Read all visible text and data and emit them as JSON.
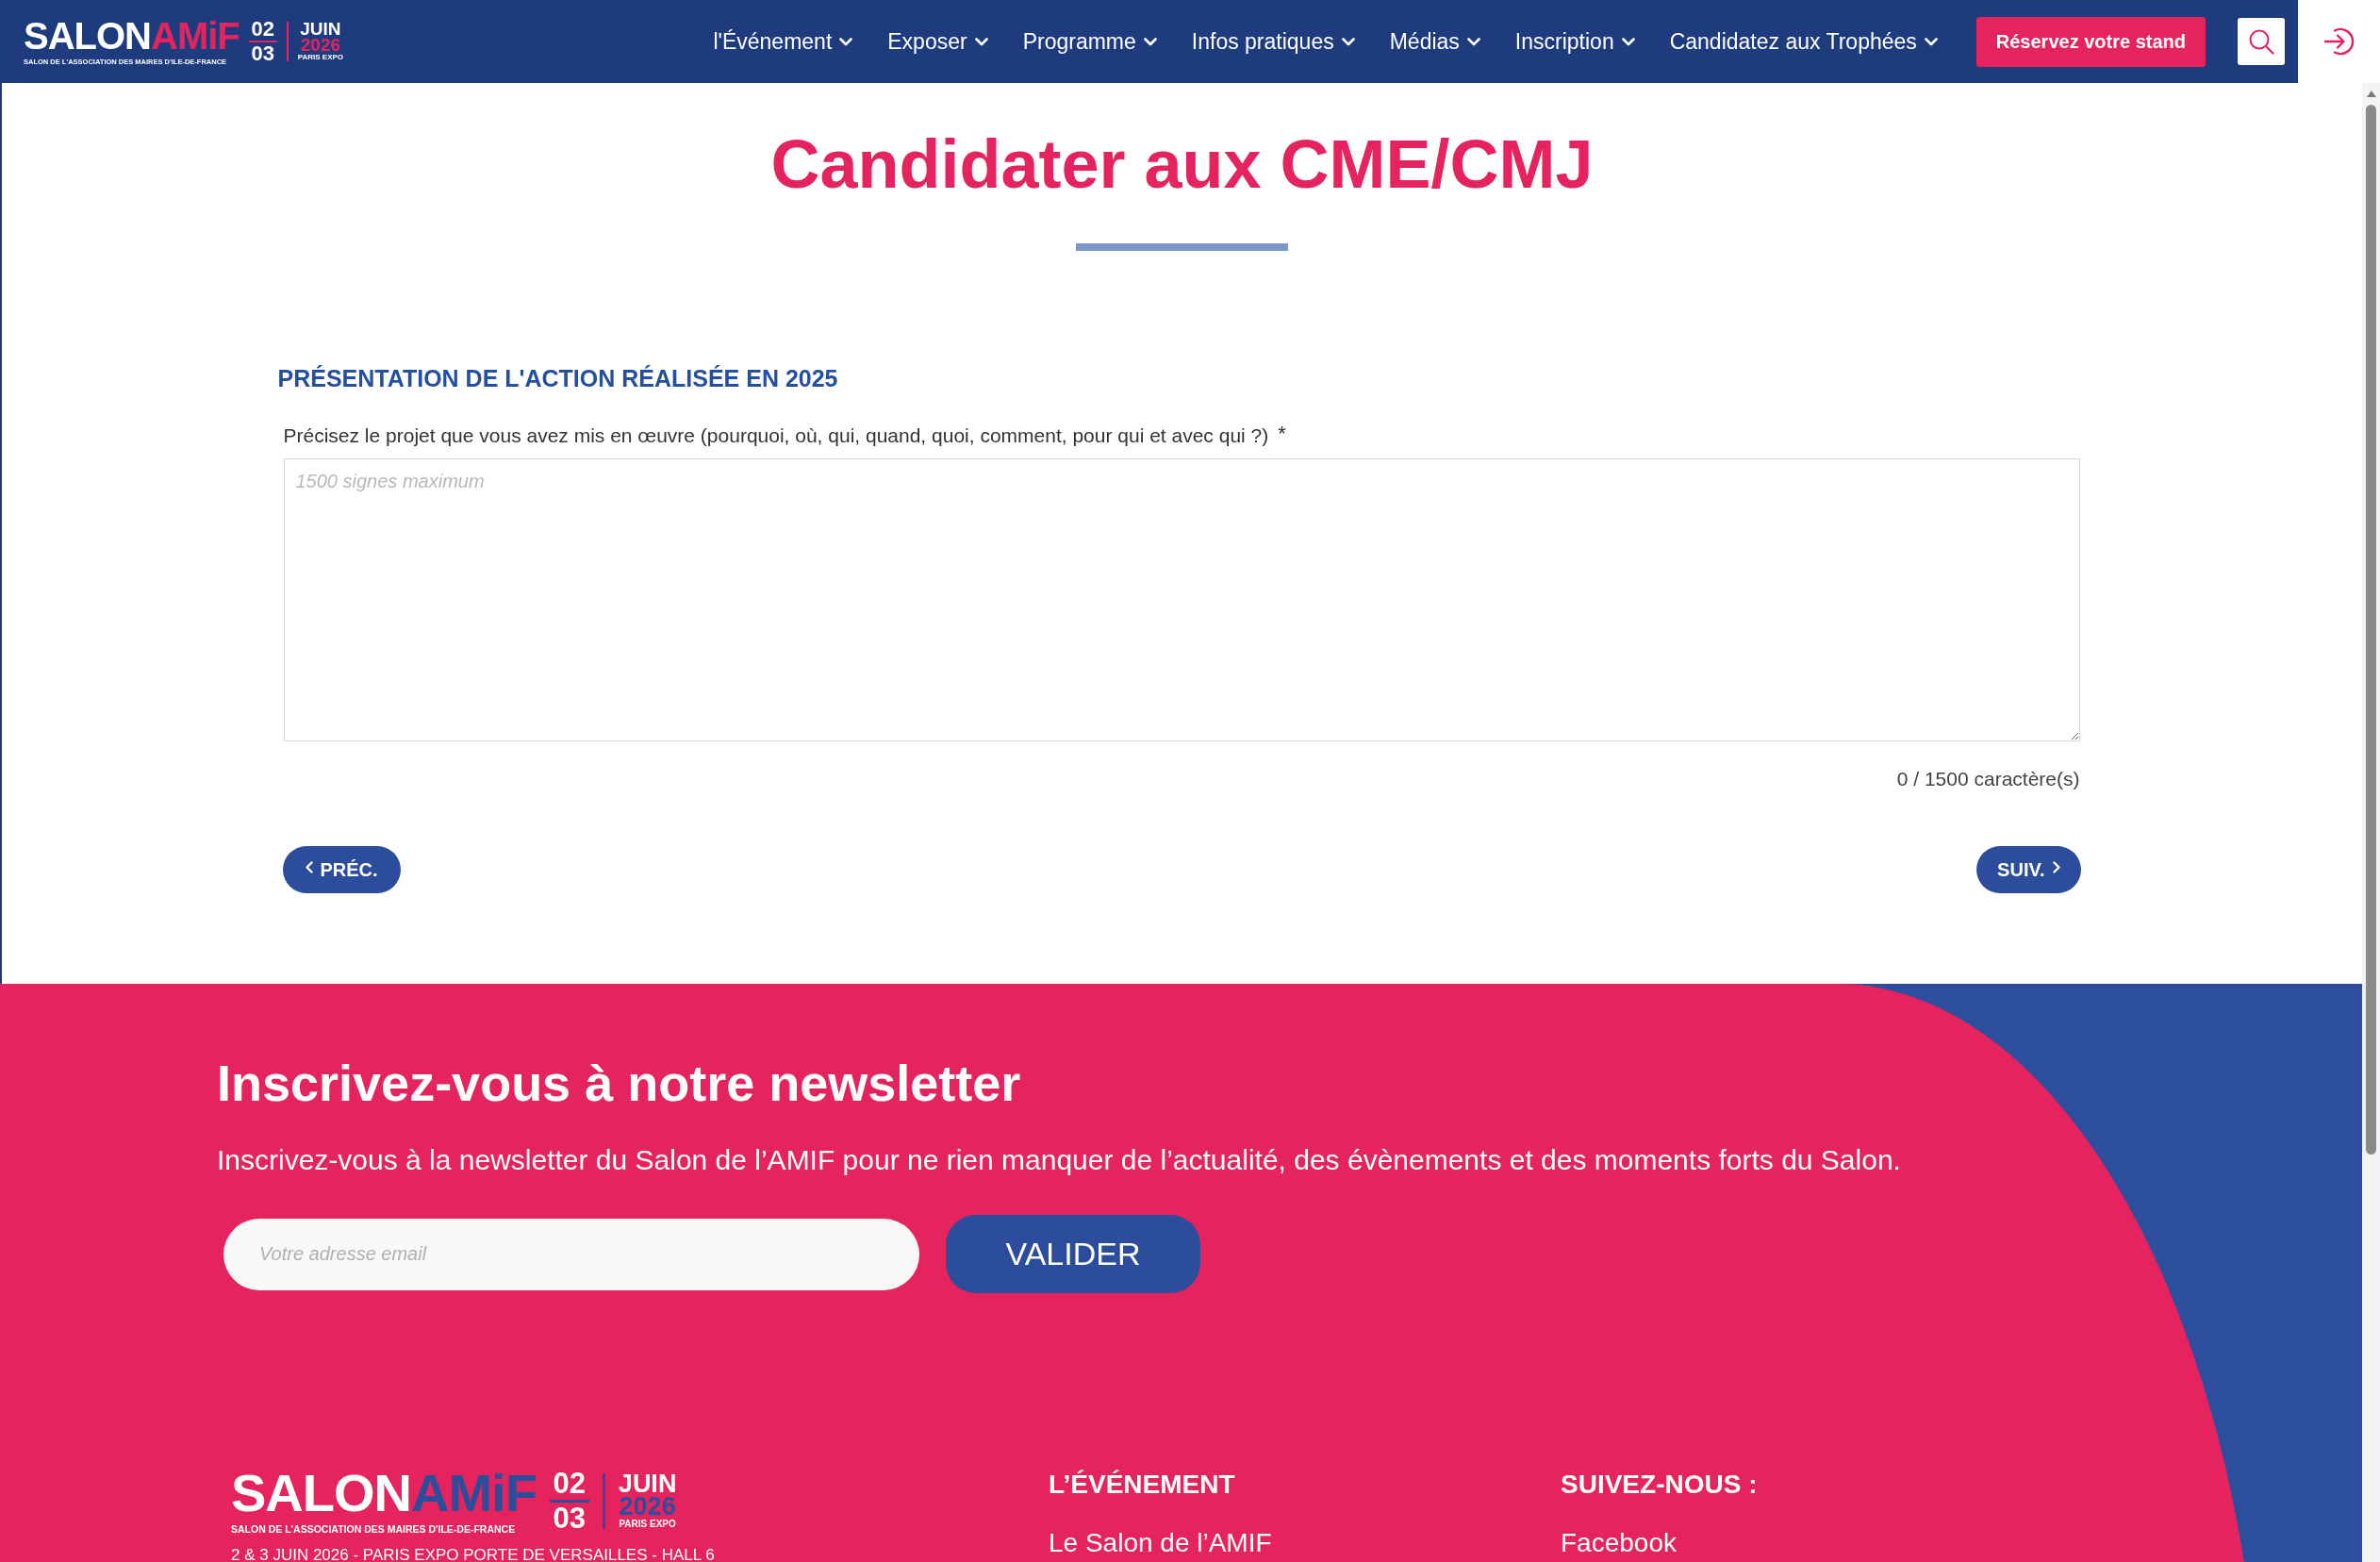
{
  "header": {
    "logo": {
      "wordmark_1": "SALON",
      "wordmark_2": "AMiF",
      "tagline": "SALON DE L'ASSOCIATION DES MAIRES D'ILE-DE-FRANCE",
      "day_1": "02",
      "day_2": "03",
      "month": "JUIN",
      "year": "2026",
      "venue": "PARIS EXPO"
    },
    "nav": [
      {
        "label": "l'Événement",
        "dropdown": true
      },
      {
        "label": "Exposer",
        "dropdown": true
      },
      {
        "label": "Programme",
        "dropdown": true
      },
      {
        "label": "Infos pratiques",
        "dropdown": true
      },
      {
        "label": "Médias",
        "dropdown": true
      },
      {
        "label": "Inscription",
        "dropdown": true
      },
      {
        "label": "Candidatez aux Trophées",
        "dropdown": true
      }
    ],
    "cta_button": "Réservez votre stand"
  },
  "page": {
    "title": "Candidater aux CME/CMJ"
  },
  "form": {
    "section_title": "PRÉSENTATION DE L'ACTION RÉALISÉE EN 2025",
    "field": {
      "label": "Précisez le projet que vous avez mis en œuvre (pourquoi, où, qui, quand, quoi, comment, pour qui et avec qui ?)",
      "required_mark": "*",
      "placeholder": "1500 signes maximum"
    },
    "counter": "0 / 1500 caractère(s)",
    "prev_button": "PRÉC.",
    "next_button": "SUIV."
  },
  "newsletter": {
    "title": "Inscrivez-vous à notre newsletter",
    "text": "Inscrivez-vous à la newsletter du Salon de l’AMIF pour ne rien manquer de l’actualité, des évènements et des moments forts du Salon.",
    "email_placeholder": "Votre adresse email",
    "submit_button": "VALIDER"
  },
  "footer": {
    "logo": {
      "wordmark_1": "SALON",
      "wordmark_2": "AMiF",
      "tagline": "SALON DE L'ASSOCIATION DES MAIRES D'ILE-DE-FRANCE",
      "day_1": "02",
      "day_2": "03",
      "month": "JUIN",
      "year": "2026",
      "venue": "PARIS EXPO"
    },
    "address": "2 & 3 JUIN 2026 - PARIS EXPO PORTE DE VERSAILLES - HALL 6",
    "columns": [
      {
        "title": "L’ÉVÉNEMENT",
        "links": [
          "Le Salon de l’AMIF"
        ]
      },
      {
        "title": "SUIVEZ-NOUS :",
        "links": [
          "Facebook"
        ]
      }
    ]
  }
}
